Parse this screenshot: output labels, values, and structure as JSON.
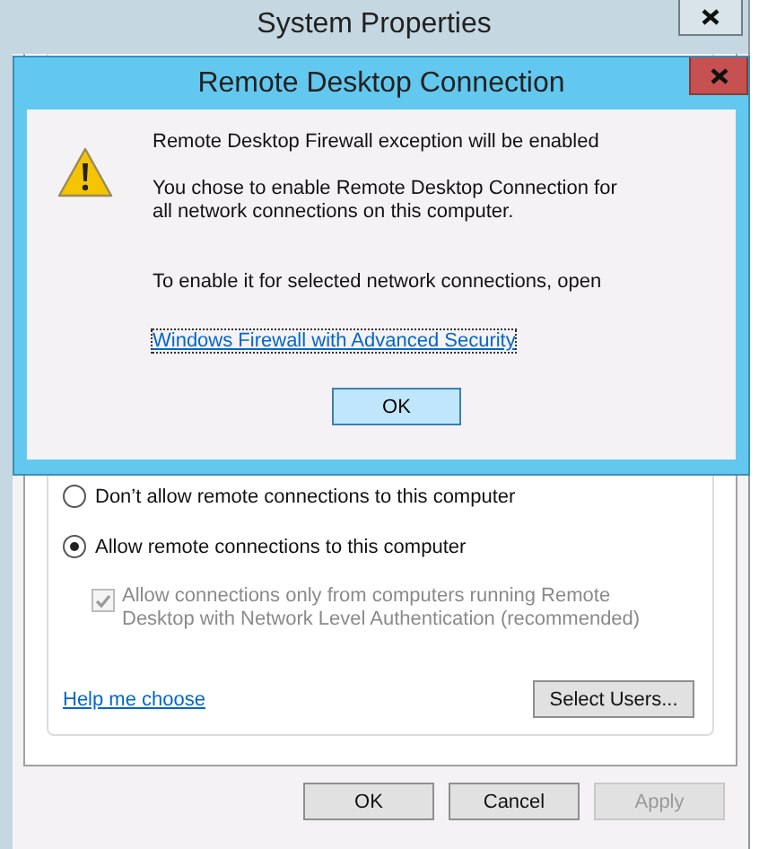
{
  "background_window": {
    "title": "System Properties",
    "options": [
      {
        "label": "Don’t allow remote connections to this computer",
        "selected": false
      },
      {
        "label": "Allow remote connections to this computer",
        "selected": true
      }
    ],
    "nla_checkbox": {
      "label": "Allow connections only from computers running Remote Desktop with Network Level Authentication (recommended)",
      "checked": true,
      "disabled": true
    },
    "help_link": "Help me choose",
    "select_users": "Select Users...",
    "buttons": [
      {
        "label": "OK",
        "disabled": false
      },
      {
        "label": "Cancel",
        "disabled": false
      },
      {
        "label": "Apply",
        "disabled": true
      }
    ]
  },
  "dialog": {
    "title": "Remote Desktop Connection",
    "heading": "Remote Desktop Firewall exception will be enabled",
    "message": "You chose to enable Remote Desktop Connection for all network connections on this computer.",
    "instruction": "To enable it for selected network connections, open",
    "link": "Windows Firewall with Advanced Security",
    "button": "OK"
  }
}
